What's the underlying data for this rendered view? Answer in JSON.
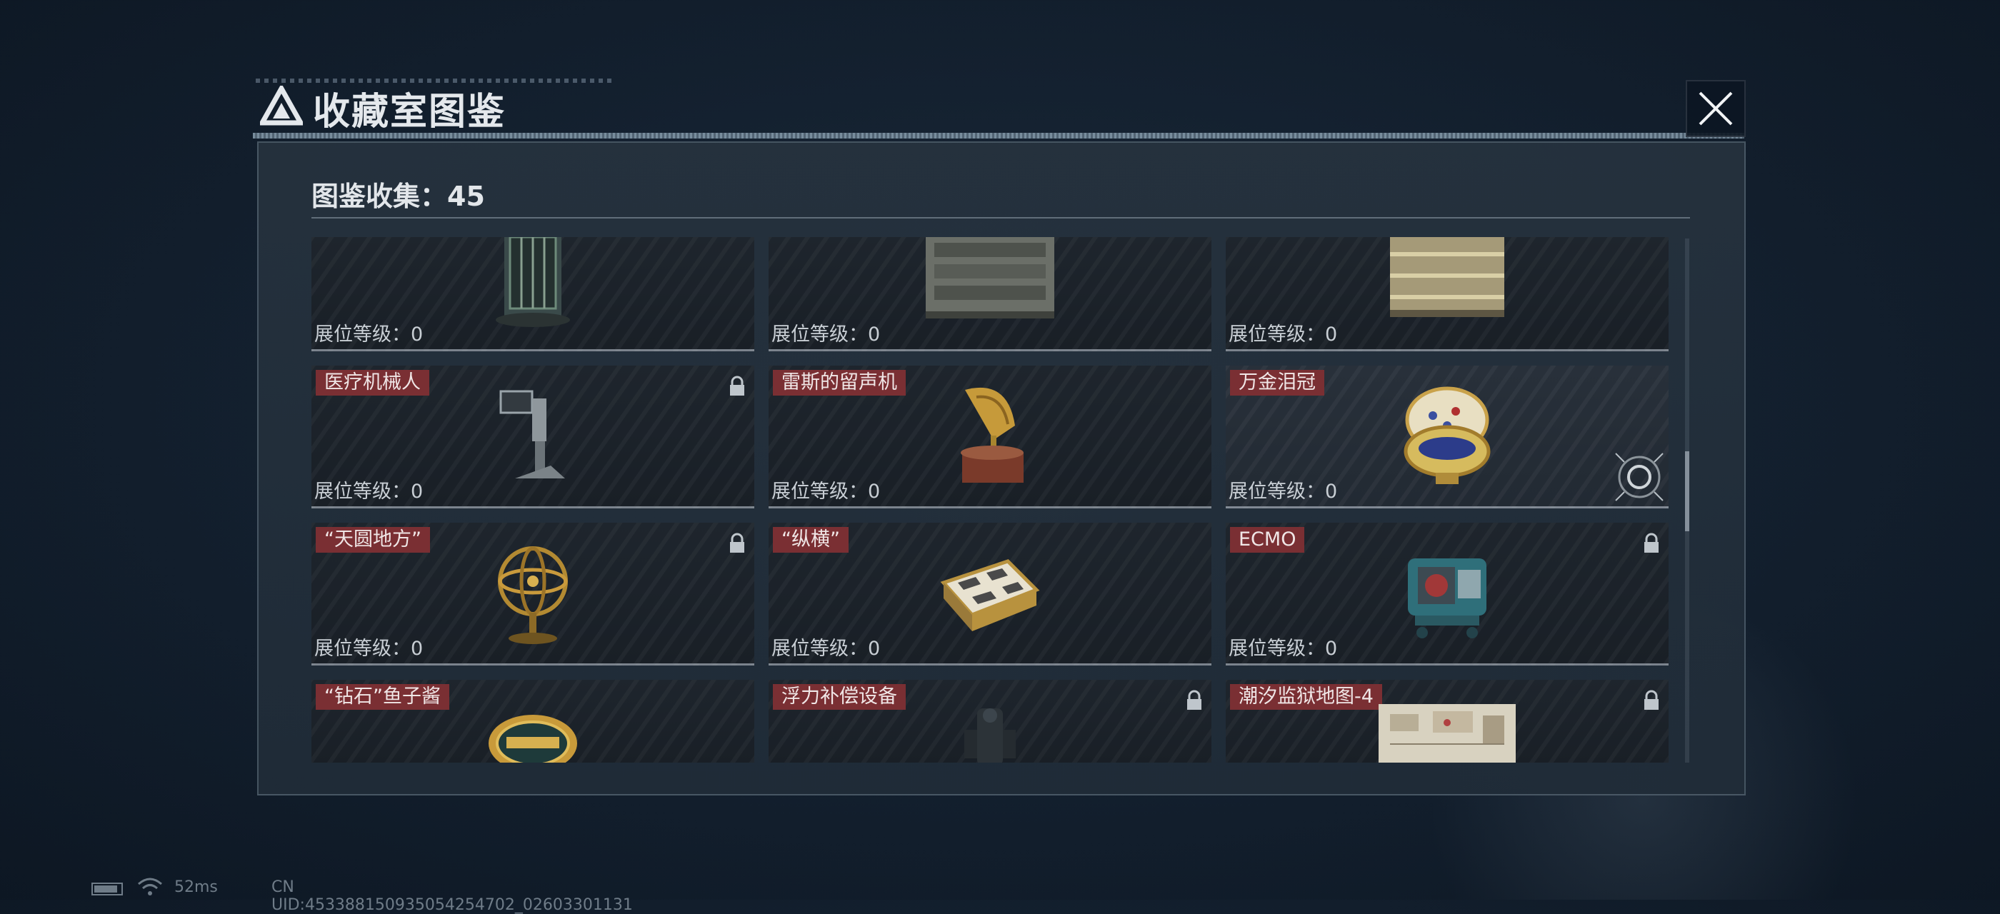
{
  "header": {
    "title": "收藏室图鉴"
  },
  "panel": {
    "collection_label": "图鉴收集：45"
  },
  "level_label": "展位等级：0",
  "cards": [
    {
      "name": "",
      "locked": false,
      "icon": "vault-cylinder-icon"
    },
    {
      "name": "",
      "locked": false,
      "icon": "server-cabinet-icon"
    },
    {
      "name": "",
      "locked": false,
      "icon": "battery-pack-icon"
    },
    {
      "name": "医疗机械人",
      "locked": true,
      "icon": "medical-robot-icon"
    },
    {
      "name": "雷斯的留声机",
      "locked": false,
      "icon": "gramophone-icon"
    },
    {
      "name": "万金泪冠",
      "locked": false,
      "icon": "jeweled-egg-icon"
    },
    {
      "name": "“天圆地方”",
      "locked": true,
      "icon": "armillary-sphere-icon"
    },
    {
      "name": "“纵横”",
      "locked": false,
      "icon": "chessboard-icon"
    },
    {
      "name": "ECMO",
      "locked": true,
      "icon": "ecmo-machine-icon"
    },
    {
      "name": "“钻石”鱼子酱",
      "locked": false,
      "icon": "caviar-tin-icon"
    },
    {
      "name": "浮力补偿设备",
      "locked": true,
      "icon": "bcd-gear-icon"
    },
    {
      "name": "潮汐监狱地图-4",
      "locked": true,
      "icon": "prison-map-icon"
    }
  ],
  "status": {
    "ping": "52ms",
    "uid": "CN UID:453388150935054254702_02603301131"
  },
  "colors": {
    "name_tag": "#7a2f33",
    "panel": "#26323e",
    "background": "#142130"
  }
}
